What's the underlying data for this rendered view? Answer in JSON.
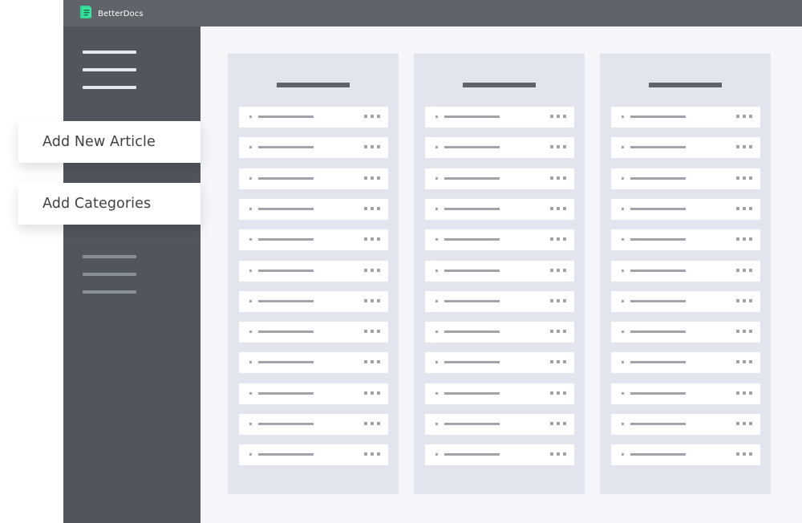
{
  "app": {
    "brand_name": "BetterDocs",
    "brand_color": "#2bd58f"
  },
  "actions": {
    "add_article_label": "Add New Article",
    "add_categories_label": "Add Categories"
  },
  "board": {
    "columns": [
      {
        "rows": 12
      },
      {
        "rows": 12
      },
      {
        "rows": 12
      }
    ]
  }
}
